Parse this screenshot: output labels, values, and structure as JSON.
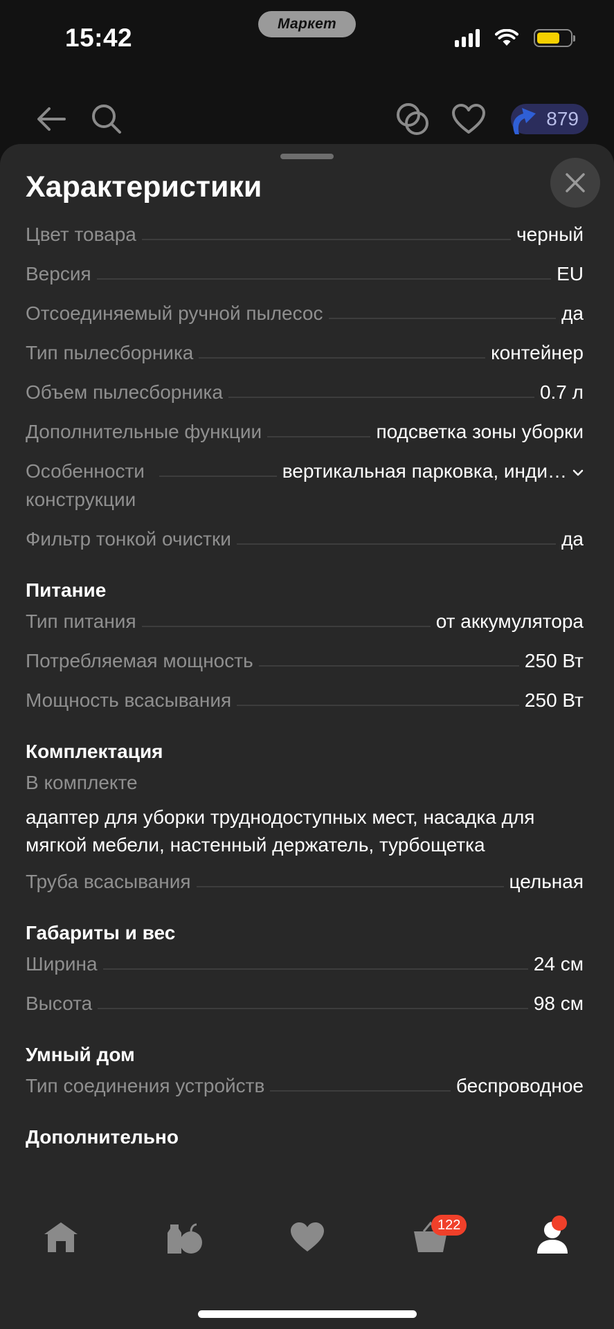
{
  "status_bar": {
    "time": "15:42",
    "app_badge": "Маркет",
    "battery_level_percent": 70
  },
  "top_nav": {
    "cashback_value": "879"
  },
  "sheet": {
    "title": "Характеристики",
    "general": [
      {
        "label": "Цвет товара",
        "value": "черный"
      },
      {
        "label": "Версия",
        "value": "EU"
      },
      {
        "label": "Отсоединяемый ручной пылесос",
        "value": "да"
      },
      {
        "label": "Тип пылесборника",
        "value": "контейнер"
      },
      {
        "label": "Объем пылесборника",
        "value": "0.7 л"
      },
      {
        "label": "Дополнительные функции",
        "value": "подсветка зоны уборки"
      },
      {
        "label": "Особенности конструкции",
        "value": "вертикальная парковка, инди…"
      },
      {
        "label": "Фильтр тонкой очистки",
        "value": "да"
      }
    ],
    "power": {
      "title": "Питание",
      "rows": [
        {
          "label": "Тип питания",
          "value": "от аккумулятора"
        },
        {
          "label": "Потребляемая мощность",
          "value": "250 Вт"
        },
        {
          "label": "Мощность всасывания",
          "value": "250 Вт"
        }
      ]
    },
    "package": {
      "title": "Комплектация",
      "included_label": "В комплекте",
      "included_value": "адаптер для уборки труднодоступных мест, насадка для мягкой мебели, настенный держатель, турбощетка",
      "rows": [
        {
          "label": "Труба всасывания",
          "value": "цельная"
        }
      ]
    },
    "dimensions": {
      "title": "Габариты и вес",
      "rows": [
        {
          "label": "Ширина",
          "value": "24 см"
        },
        {
          "label": "Высота",
          "value": "98 см"
        }
      ]
    },
    "smart_home": {
      "title": "Умный дом",
      "rows": [
        {
          "label": "Тип соединения устройств",
          "value": "беспроводное"
        }
      ]
    },
    "extra": {
      "title": "Дополнительно"
    }
  },
  "tab_bar": {
    "cart_badge": "122"
  },
  "colors": {
    "background": "#121212",
    "sheet": "#282828",
    "label": "#8f8f8f",
    "badge": "#f0402a",
    "cashback_bg": "#2b2d5c"
  }
}
